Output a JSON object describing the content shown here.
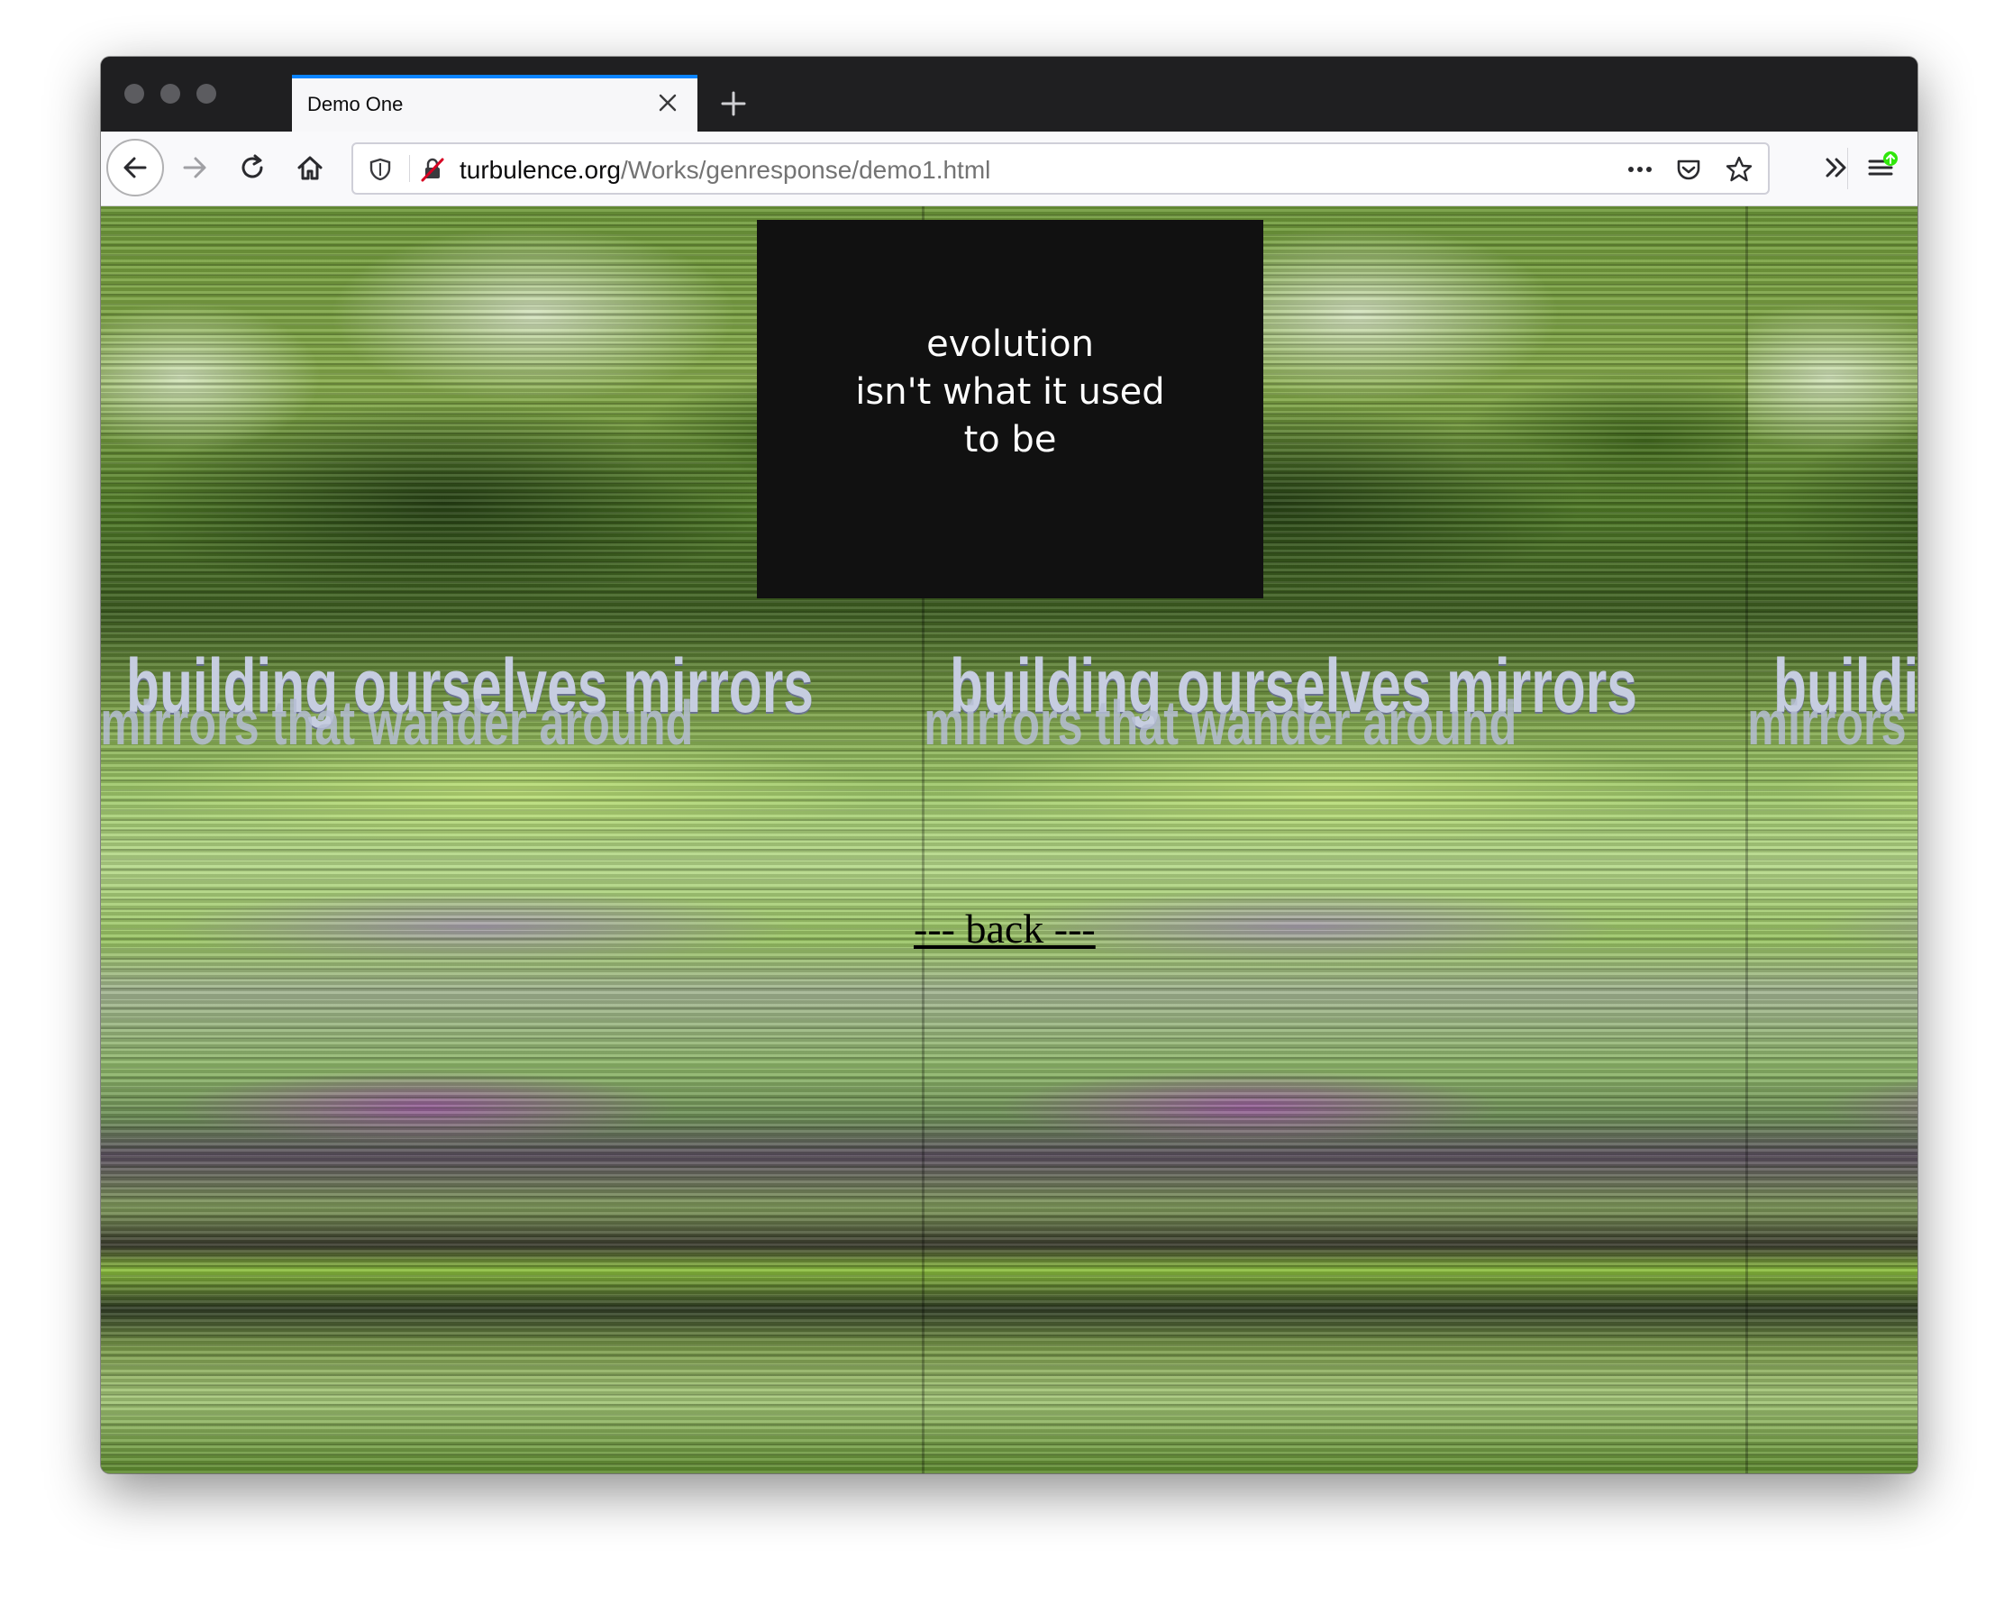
{
  "browser": {
    "tab": {
      "title": "Demo One"
    },
    "url": {
      "host": "turbulence.org",
      "path": "/Works/genresponse/demo1.html"
    },
    "icons": {
      "traffic_lights": [
        "close-dot",
        "minimize-dot",
        "zoom-dot"
      ],
      "nav": [
        "back-arrow-icon",
        "forward-arrow-icon",
        "reload-icon",
        "home-icon"
      ],
      "urlbar": [
        "shield-icon",
        "insecure-lock-icon",
        "more-dots-icon",
        "pocket-icon",
        "star-icon"
      ],
      "toolbar": [
        "overflow-chevrons-icon",
        "hamburger-menu-icon",
        "update-badge-icon"
      ]
    },
    "colors": {
      "accent": "#0a84ff",
      "update_badge": "#30e60b",
      "insecure": "#d70022"
    }
  },
  "page": {
    "box_text": "evolution\nisn't what it used\nto be",
    "tiles": [
      {
        "line1": "building ourselves mirrors",
        "line2": "mirrors that wander around"
      },
      {
        "line1": "building ourselves mirrors",
        "line2": "mirrors that wander around"
      },
      {
        "line1": "building ourselves mirrors",
        "line2": "mirrors that wander around"
      }
    ],
    "back_link": "--- back ---"
  }
}
